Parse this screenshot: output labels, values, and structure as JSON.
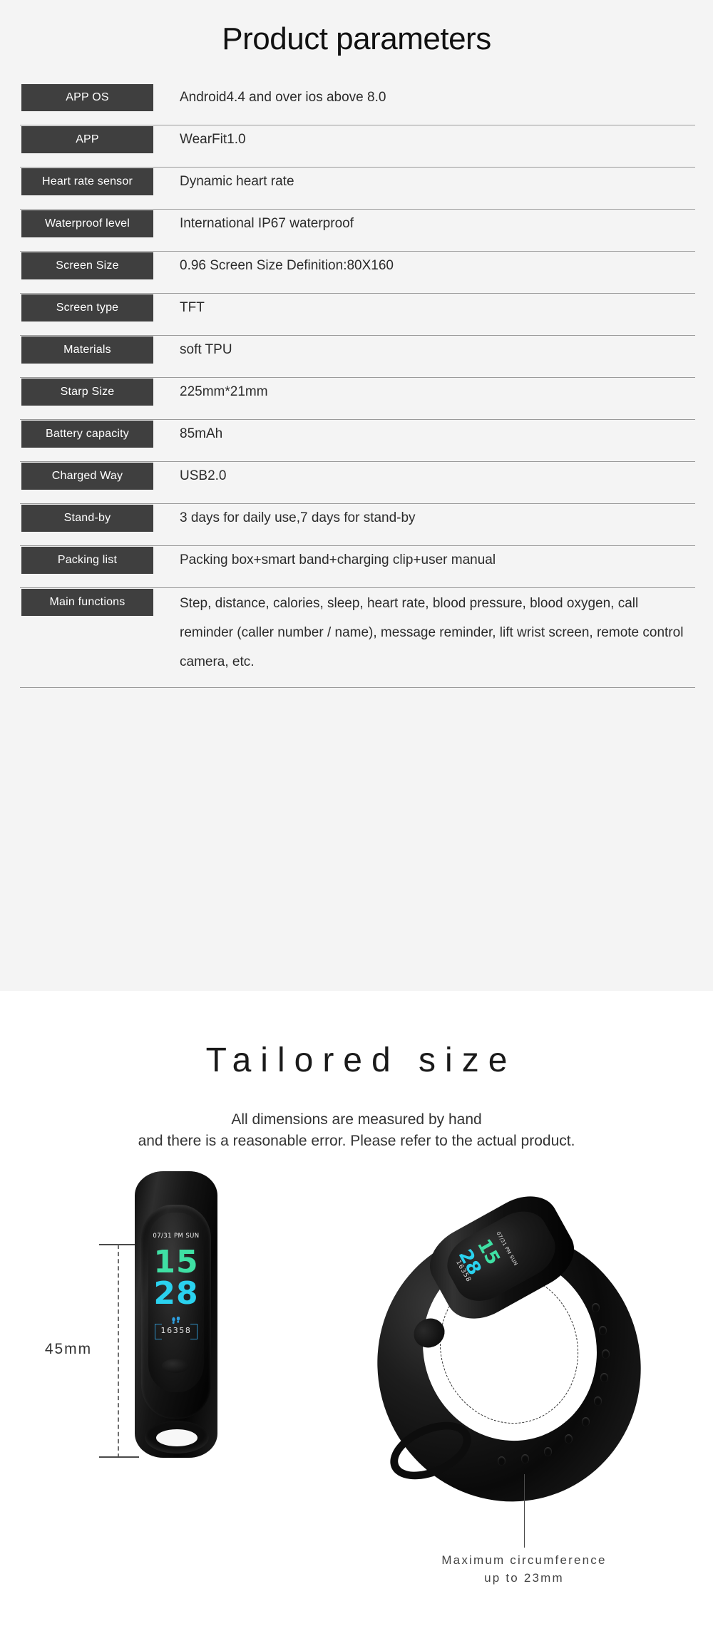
{
  "spec_section": {
    "title": "Product parameters",
    "rows": [
      {
        "label": "APP OS",
        "value": "Android4.4 and over  ios above 8.0"
      },
      {
        "label": "APP",
        "value": "WearFit1.0"
      },
      {
        "label": "Heart rate sensor",
        "value": "Dynamic heart rate"
      },
      {
        "label": "Waterproof level",
        "value": "International IP67 waterproof"
      },
      {
        "label": "Screen Size",
        "value": "0.96 Screen Size  Definition:80X160"
      },
      {
        "label": "Screen type",
        "value": "TFT"
      },
      {
        "label": "Materials",
        "value": "soft TPU"
      },
      {
        "label": "Starp Size",
        "value": "225mm*21mm"
      },
      {
        "label": "Battery capacity",
        "value": "85mAh"
      },
      {
        "label": "Charged Way",
        "value": "USB2.0"
      },
      {
        "label": "Stand-by",
        "value": "3 days for daily use,7 days for stand-by"
      },
      {
        "label": "Packing list",
        "value": "Packing box+smart band+charging clip+user manual"
      },
      {
        "label": "Main functions",
        "value": "Step, distance, calories, sleep, heart rate, blood pressure, blood oxygen, call reminder (caller number / name), message reminder, lift wrist screen, remote control camera, etc."
      }
    ]
  },
  "size_section": {
    "title": "Tailored size",
    "subtitle_line1": "All dimensions are measured by hand",
    "subtitle_line2": "and there is a reasonable error. Please refer to the actual product.",
    "height_label": "45mm",
    "circumference_line1": "Maximum circumference",
    "circumference_line2": "up to 23mm"
  },
  "watch_screen": {
    "date": "07/31  PM  SUN",
    "hour": "15",
    "minute": "28",
    "steps": "16358",
    "feet_icon": "  ",
    "hour_color": "#3fe0a4",
    "minute_color": "#2ad2ef",
    "steps_accent": "#2f8fc4"
  },
  "colors": {
    "spec_background": "#f4f4f4",
    "size_background": "#ffffff",
    "chip_background": "#3f3f3f",
    "chip_text": "#ffffff",
    "divider": "#9a9a9a",
    "body_text": "#2b2b2b"
  }
}
